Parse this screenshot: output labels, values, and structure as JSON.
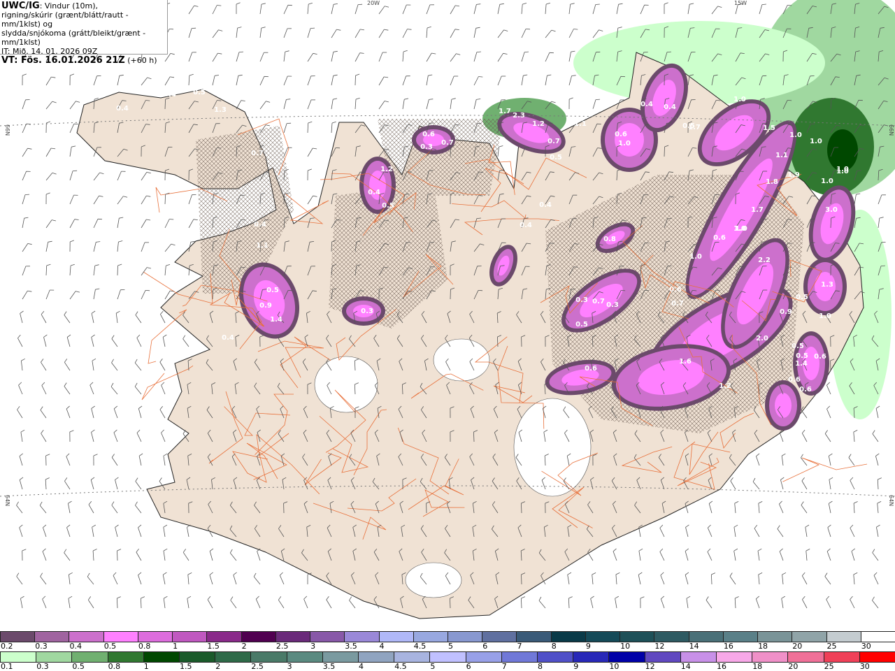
{
  "title": {
    "model": "UWC/IG",
    "line1": ": Vindur (10m),",
    "line2": "rigning/skúrir (grænt/blátt/rautt - mm/1klst) og",
    "line3": "slydda/snjókoma (grátt/bleikt/grænt - mm/1klst)",
    "it": "IT: Mið. 14. 01. 2026 09Z",
    "vt": "VT: Fös. 16.01.2026 21Z",
    "vt_offset": " (+60 h)"
  },
  "grid_labels": {
    "lon_20w": "20W",
    "lon_15w": "15W",
    "lat_66n_left": "66N",
    "lat_66n_right": "66N",
    "lat_64n_left": "64N",
    "lat_64n_right": "64N"
  },
  "precip_labels": [
    "0.4",
    "0.4",
    "0.5",
    "1.3",
    "0.7",
    "1.2",
    "0.4",
    "0.5",
    "0.6",
    "0.3",
    "0.7",
    "0.6",
    "0.5",
    "1.7",
    "2.3",
    "1.2",
    "0.9",
    "1.1",
    "0.7",
    "0.5",
    "1.0",
    "0.6",
    "0.4",
    "0.4",
    "0.5",
    "1.7",
    "1.5",
    "1.0",
    "1.1",
    "1.0",
    "1.0",
    "0.4",
    "0.4",
    "0.8",
    "0.4",
    "1.1",
    "0.5",
    "0.9",
    "1.4",
    "0.4",
    "0.3",
    "0.3",
    "0.5",
    "0.7",
    "0.3",
    "0.6",
    "1.6",
    "1.2",
    "1.9",
    "1.8",
    "1.7",
    "1.0",
    "1.0",
    "0.6",
    "1.0",
    "0.6",
    "0.7",
    "2.2",
    "3.0",
    "1.3",
    "0.5",
    "0.9",
    "1.0",
    "0.5",
    "2.0",
    "0.5",
    "0.6",
    "1.4",
    "0.6",
    "0.6",
    "1.0",
    "1.0",
    "1.0"
  ],
  "legend_snow": {
    "labels": [
      "0.2",
      "0.3",
      "0.4",
      "0.5",
      "0.8",
      "1",
      "1.5",
      "2",
      "2.5",
      "3",
      "3.5",
      "4",
      "4.5",
      "5",
      "6",
      "7",
      "8",
      "9",
      "10",
      "12",
      "14",
      "16",
      "18",
      "20",
      "25",
      "30"
    ],
    "colors": [
      "#6b4a6b",
      "#a064a0",
      "#cc70cc",
      "#ff80ff",
      "#dd6ddd",
      "#c058c0",
      "#8a2a8a",
      "#500050",
      "#6a2a7a",
      "#8858a8",
      "#9a88d8",
      "#b0b8f8",
      "#98a8e0",
      "#8898d0",
      "#6070a0",
      "#3a5a78",
      "#0a3a48",
      "#154a58",
      "#1e5058",
      "#2e5a62",
      "#4a7078",
      "#5a8088",
      "#7a9498",
      "#90a4a8",
      "#c4ccd0",
      "#ffffff"
    ]
  },
  "legend_rain": {
    "labels": [
      "0.1",
      "0.3",
      "0.5",
      "0.8",
      "1",
      "1.5",
      "2",
      "2.5",
      "3",
      "3.5",
      "4",
      "4.5",
      "5",
      "6",
      "7",
      "8",
      "9",
      "10",
      "12",
      "14",
      "16",
      "18",
      "20",
      "25",
      "30"
    ],
    "colors": [
      "#ccffcc",
      "#a0d8a0",
      "#70b070",
      "#307830",
      "#004800",
      "#1a5a2a",
      "#2e6a48",
      "#4a7a68",
      "#5a8a80",
      "#7a9aa0",
      "#90a4c0",
      "#a8b4e0",
      "#c0c0ff",
      "#98a0e8",
      "#7078d8",
      "#5050c8",
      "#2828b8",
      "#0000a8",
      "#6048c0",
      "#c890e8",
      "#f8a8e8",
      "#f090c8",
      "#f07098",
      "#f04058",
      "#ff0000"
    ]
  },
  "colors": {
    "land": "#f0e2d4",
    "roads": "#e8703a",
    "glacier": "#ffffff",
    "sea": "#ffffff"
  }
}
